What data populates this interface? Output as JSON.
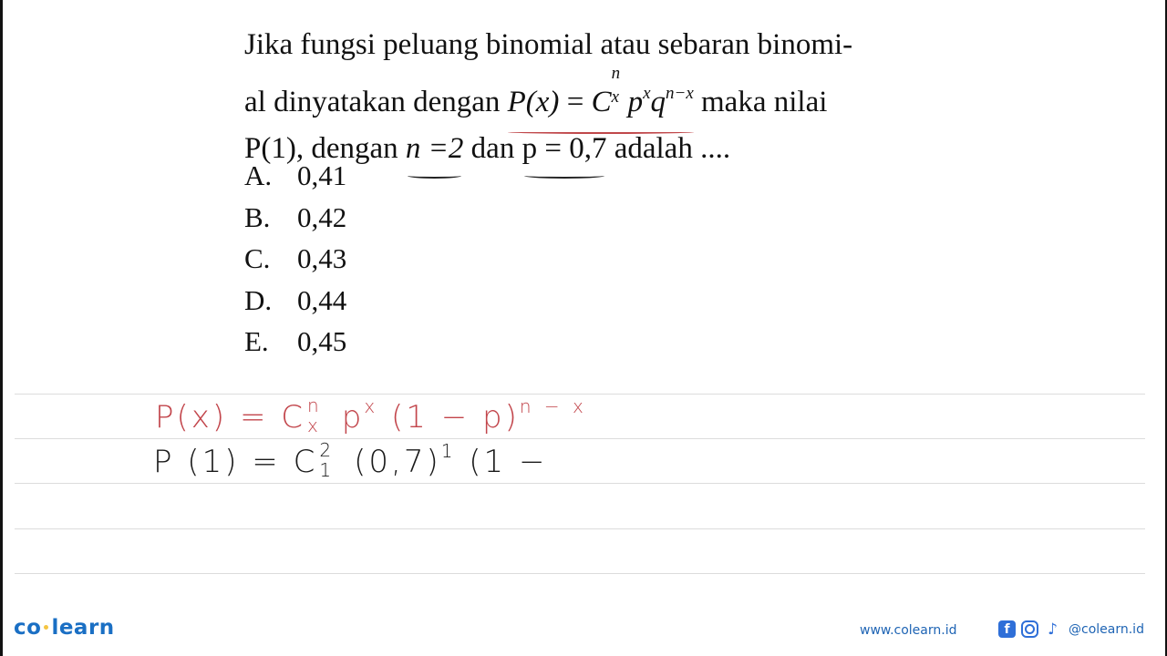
{
  "question": {
    "line1": "Jika fungsi peluang binomial atau sebaran binomi-",
    "line2_prefix": "al dinyatakan dengan ",
    "formula": {
      "lhs": "P(x)",
      "eq": " = ",
      "C": "C",
      "C_sup": "n",
      "C_sub": "x",
      "p": "p",
      "p_sup": "x",
      "q": "q",
      "q_sup": "n−x"
    },
    "line2_suffix": " maka nilai",
    "line3_prefix": "P(1), dengan ",
    "n_expr": "n =2",
    "line3_mid": " dan ",
    "p_expr": "p = 0,7",
    "line3_suffix": " adalah ...."
  },
  "options": [
    {
      "letter": "A.",
      "value": "0,41"
    },
    {
      "letter": "B.",
      "value": "0,42"
    },
    {
      "letter": "C.",
      "value": "0,43"
    },
    {
      "letter": "D.",
      "value": "0,44"
    },
    {
      "letter": "E.",
      "value": "0,45"
    }
  ],
  "handwriting": {
    "line1": {
      "lhs": "P(x) = C",
      "C_sup": "n",
      "C_sub": "x",
      "p": " p",
      "p_sup": "x",
      "rest": " (1 − p)",
      "rest_sup": "n − x"
    },
    "line2": {
      "lhs": "P (1) = C",
      "C_sup": "2",
      "C_sub": "1",
      "rest": " (0,7)",
      "rest_sup": "1",
      "tail": " (1 −"
    }
  },
  "colors": {
    "brand": "#1a6fc4",
    "annotation_red": "#c2454b"
  },
  "footer": {
    "logo_left": "co",
    "logo_right": "learn",
    "website": "www.colearn.id",
    "social_icons": [
      "facebook-icon",
      "instagram-icon",
      "tiktok-icon"
    ],
    "handle": "@colearn.id"
  }
}
